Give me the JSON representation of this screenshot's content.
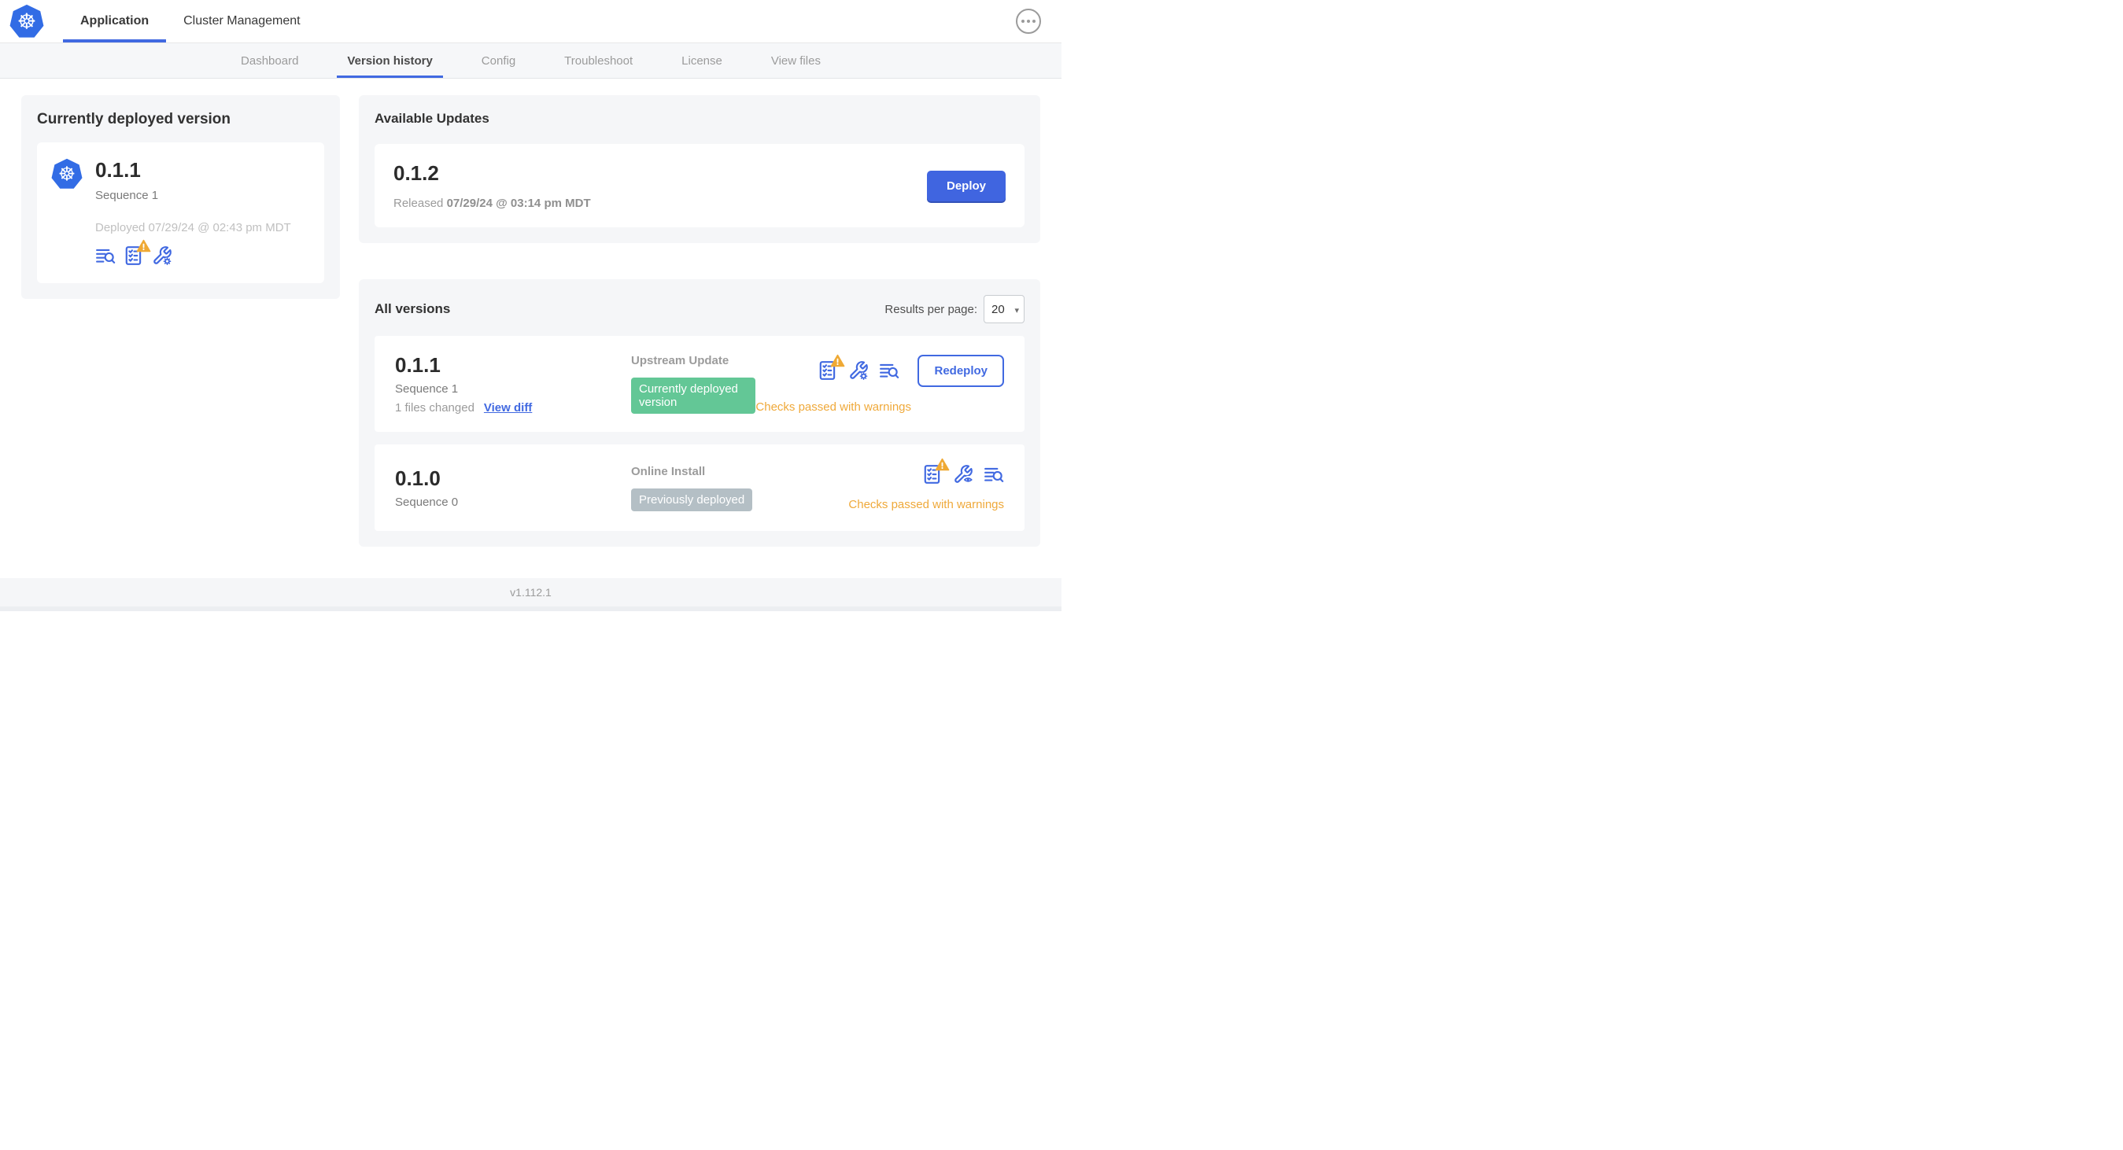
{
  "header": {
    "tabs": [
      {
        "label": "Application",
        "active": true
      },
      {
        "label": "Cluster Management",
        "active": false
      }
    ]
  },
  "subnav": {
    "tabs": [
      "Dashboard",
      "Version history",
      "Config",
      "Troubleshoot",
      "License",
      "View files"
    ],
    "active": "Version history"
  },
  "deployed_card": {
    "title": "Currently deployed version",
    "version": "0.1.1",
    "sequence": "Sequence 1",
    "deployed_date": "Deployed 07/29/24 @ 02:43 pm MDT"
  },
  "updates_card": {
    "title": "Available Updates",
    "version": "0.1.2",
    "released_prefix": "Released",
    "released_date": "07/29/24 @ 03:14 pm MDT",
    "deploy_label": "Deploy"
  },
  "all_versions": {
    "title": "All versions",
    "results_label": "Results per page:",
    "results_value": "20",
    "rows": [
      {
        "version": "0.1.1",
        "sequence": "Sequence 1",
        "files_changed": "1 files changed",
        "view_diff": "View diff",
        "source": "Upstream Update",
        "badge": "Currently deployed version",
        "badge_type": "green",
        "action": "Redeploy",
        "checks": "Checks passed with warnings"
      },
      {
        "version": "0.1.0",
        "sequence": "Sequence 0",
        "source": "Online Install",
        "badge": "Previously deployed",
        "badge_type": "gray",
        "checks": "Checks passed with warnings"
      }
    ]
  },
  "footer": {
    "version": "v1.112.1"
  },
  "colors": {
    "accent_blue": "#4169e1",
    "deploy_button": "#4065e0",
    "badge_green": "#63c796",
    "badge_gray": "#b4bfc5",
    "warning_amber": "#efa93a",
    "kubernetes_blue": "#326ce5",
    "card_gray": "#f5f6f8"
  }
}
